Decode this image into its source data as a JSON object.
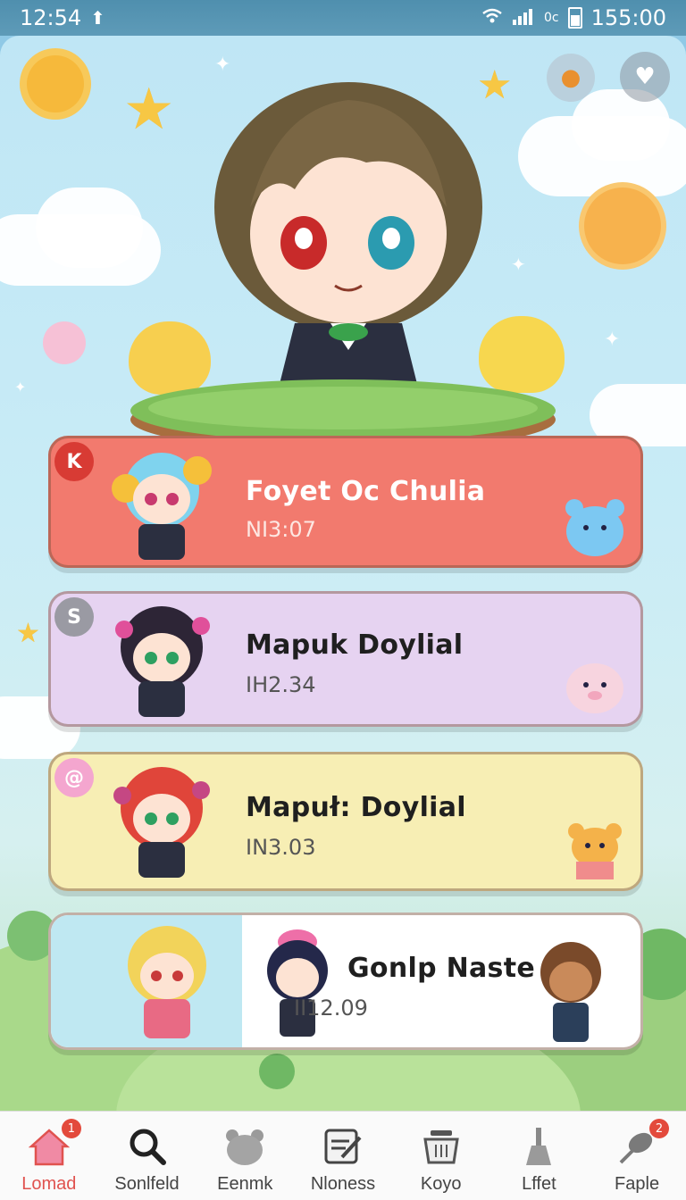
{
  "status_bar": {
    "time": "12:54",
    "battery_text": "155:00",
    "signal_text": "0c"
  },
  "top_buttons": {
    "left_icon": "fox-sticker-icon",
    "right_icon": "heart-board-icon"
  },
  "cards": [
    {
      "title": "Foyet Oc Chulia",
      "subtitle": "NI3:07",
      "badge_glyph": "K",
      "accent": "#f27a6e"
    },
    {
      "title": "Mapuk Doylial",
      "subtitle": "IH2.34",
      "badge_glyph": "S",
      "accent": "#e6d3f1"
    },
    {
      "title": "Mapuł: Doylial",
      "subtitle": "IN3.03",
      "badge_glyph": "@",
      "accent": "#f7eeb4"
    },
    {
      "title": "Gonlp Naste",
      "subtitle": "II12.09",
      "badge_glyph": "",
      "accent": "#ffffff"
    }
  ],
  "nav": [
    {
      "label": "Lomad",
      "icon": "home-icon",
      "badge": "1",
      "active": true
    },
    {
      "label": "Sonlfeld",
      "icon": "search-icon",
      "badge": "",
      "active": false
    },
    {
      "label": "Eenmk",
      "icon": "bear-icon",
      "badge": "",
      "active": false
    },
    {
      "label": "Nloness",
      "icon": "edit-note-icon",
      "badge": "",
      "active": false
    },
    {
      "label": "Koyo",
      "icon": "basket-icon",
      "badge": "",
      "active": false
    },
    {
      "label": "Lffet",
      "icon": "broom-icon",
      "badge": "",
      "active": false
    },
    {
      "label": "Faple",
      "icon": "leaf-icon",
      "badge": "2",
      "active": false
    }
  ]
}
